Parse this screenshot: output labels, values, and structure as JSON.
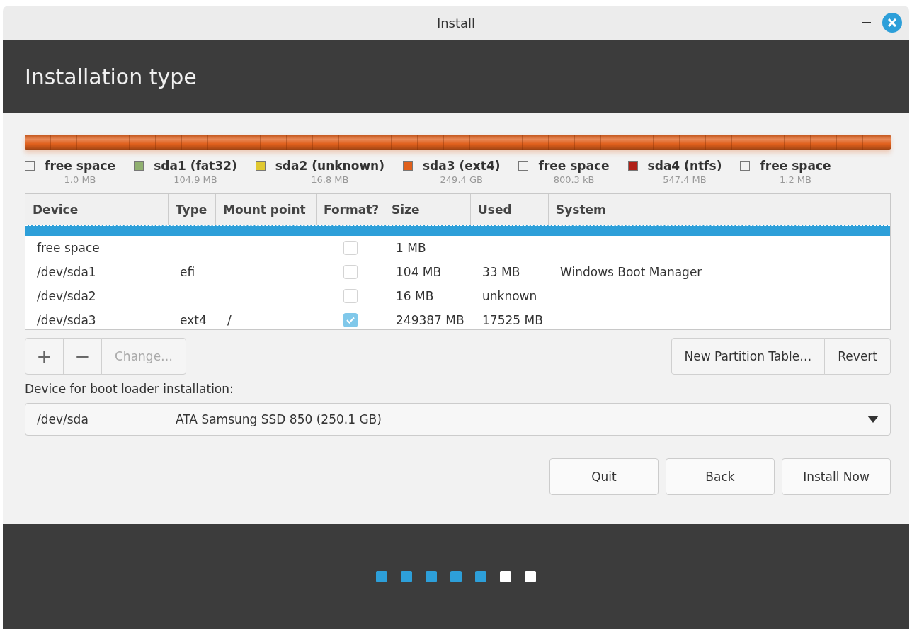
{
  "window": {
    "title": "Install"
  },
  "header": {
    "title": "Installation type"
  },
  "legend": [
    {
      "name": "free space",
      "size": "1.0 MB",
      "color": "#f2f2f2"
    },
    {
      "name": "sda1 (fat32)",
      "size": "104.9 MB",
      "color": "#90b070"
    },
    {
      "name": "sda2 (unknown)",
      "size": "16.8 MB",
      "color": "#e0c830"
    },
    {
      "name": "sda3 (ext4)",
      "size": "249.4 GB",
      "color": "#e0601c"
    },
    {
      "name": "free space",
      "size": "800.3 kB",
      "color": "#f2f2f2"
    },
    {
      "name": "sda4 (ntfs)",
      "size": "547.4 MB",
      "color": "#b02018"
    },
    {
      "name": "free space",
      "size": "1.2 MB",
      "color": "#f2f2f2"
    }
  ],
  "table": {
    "columns": [
      "Device",
      "Type",
      "Mount point",
      "Format?",
      "Size",
      "Used",
      "System"
    ],
    "rows": [
      {
        "selected": true,
        "device": "",
        "type": "",
        "mount": "",
        "size": "",
        "used": "",
        "system": ""
      },
      {
        "selected": false,
        "device": "free space",
        "type": "",
        "mount": "",
        "format": false,
        "size": "1 MB",
        "used": "",
        "system": ""
      },
      {
        "selected": false,
        "device": "/dev/sda1",
        "type": "efi",
        "mount": "",
        "format": false,
        "size": "104 MB",
        "used": "33 MB",
        "system": "Windows Boot Manager"
      },
      {
        "selected": false,
        "device": "/dev/sda2",
        "type": "",
        "mount": "",
        "format": false,
        "size": "16 MB",
        "used": "unknown",
        "system": ""
      },
      {
        "selected": false,
        "device": "/dev/sda3",
        "type": "ext4",
        "mount": "/",
        "format": true,
        "size": "249387 MB",
        "used": "17525 MB",
        "system": ""
      }
    ]
  },
  "toolbar": {
    "add": "+",
    "remove": "−",
    "change": {
      "label": "Change…",
      "disabled": true
    },
    "new_table": "New Partition Table…",
    "revert": "Revert"
  },
  "bootloader": {
    "label": "Device for boot loader installation:",
    "device": "/dev/sda",
    "description": "ATA Samsung SSD 850 (250.1 GB)"
  },
  "buttons": [
    "Quit",
    "Back",
    "Install Now"
  ],
  "steps": [
    {
      "done": true
    },
    {
      "done": true
    },
    {
      "done": true
    },
    {
      "done": true
    },
    {
      "done": true
    },
    {
      "done": false
    },
    {
      "done": false
    }
  ]
}
